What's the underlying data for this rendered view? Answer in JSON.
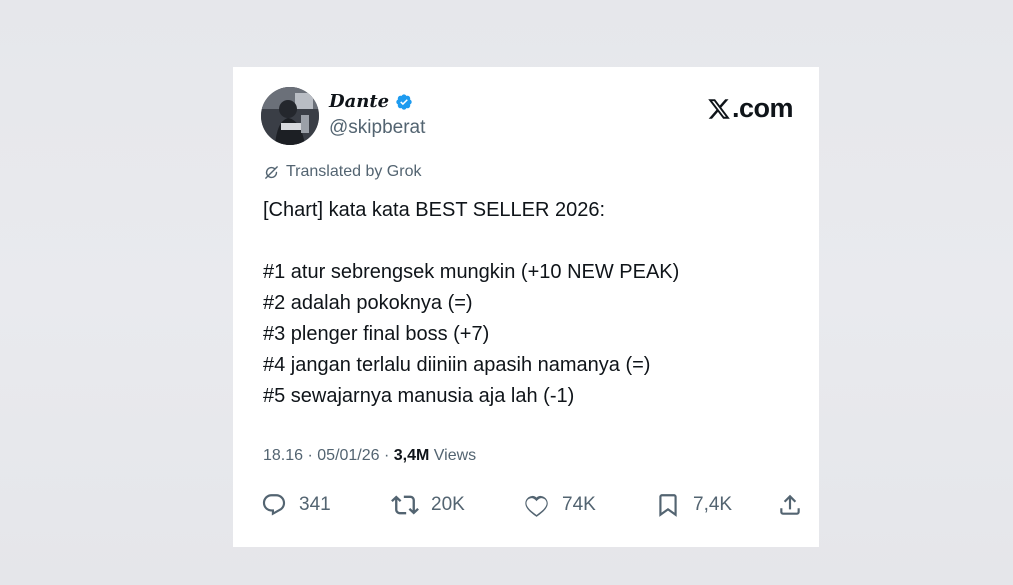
{
  "author": {
    "name": "Dante",
    "handle": "@skipberat",
    "verified": true
  },
  "brand": {
    "label": ".com",
    "logo": "x-logo"
  },
  "translation": {
    "label": "Translated by Grok",
    "icon": "translate-icon"
  },
  "tweet": {
    "lines": [
      "[Chart] kata kata BEST SELLER 2026:",
      "",
      "#1 atur sebrengsek mungkin (+10 NEW PEAK)",
      "#2 adalah pokoknya (=)",
      "#3 plenger final boss (+7)",
      "#4 jangan terlalu diiniin apasih namanya (=)",
      "#5 sewajarnya manusia aja lah (-1)"
    ]
  },
  "meta": {
    "time": "18.16",
    "separator1": " · ",
    "date": "05/01/26",
    "separator2": " · ",
    "views_count": "3,4M",
    "views_label": " Views"
  },
  "actions": {
    "replies": "341",
    "reposts": "20K",
    "likes": "74K",
    "bookmarks": "7,4K"
  },
  "colors": {
    "text_primary": "#0f1419",
    "text_secondary": "#536471",
    "verified_blue": "#1d9bf0",
    "background": "#e8e9ed",
    "card": "#ffffff"
  }
}
